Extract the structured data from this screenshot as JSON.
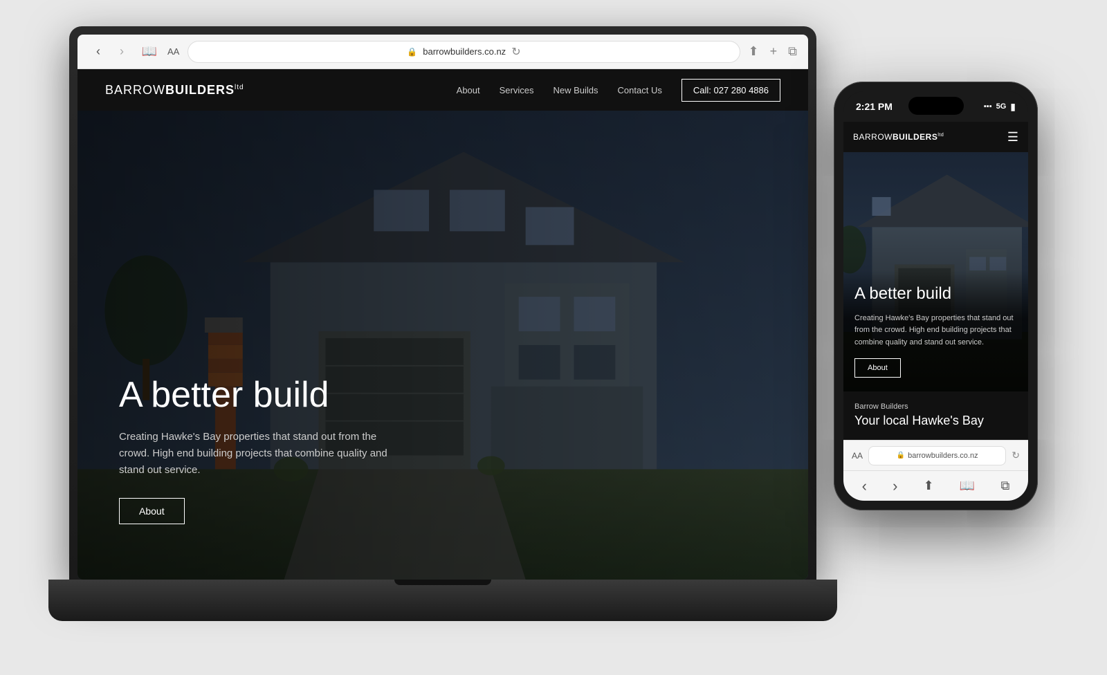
{
  "laptop": {
    "browser": {
      "aa_label": "AA",
      "url": "barrowbuilders.co.nz",
      "lock_symbol": "🔒",
      "refresh_symbol": "↻",
      "share_symbol": "⬆",
      "tabs_symbol": "⧉",
      "bookmark_symbol": "📖",
      "plus_symbol": "+"
    },
    "website": {
      "logo_text_normal": "BARROW",
      "logo_text_bold": "BUILDERS",
      "logo_super": "ltd",
      "nav_links": [
        "About",
        "Services",
        "New Builds",
        "Contact Us"
      ],
      "nav_cta": "Call: 027 280 4886",
      "hero_title": "A better build",
      "hero_subtitle": "Creating Hawke's Bay properties that stand out from the crowd. High end building projects that combine quality and stand out service.",
      "hero_button": "About"
    }
  },
  "phone": {
    "status_bar": {
      "time": "2:21 PM",
      "signal": "▪▪▪",
      "five_g": "5G",
      "battery": "▮"
    },
    "website": {
      "logo_text_normal": "BARROW",
      "logo_text_bold": "BUILDERS",
      "logo_super": "ltd",
      "hamburger": "☰",
      "hero_title": "A better build",
      "hero_subtitle": "Creating Hawke's Bay properties that stand out from the crowd. High end building projects that combine quality and stand out service.",
      "hero_button": "About",
      "section_label": "Barrow Builders",
      "section_title": "Your local Hawke's Bay"
    },
    "browser_bar": {
      "aa": "AA",
      "url": "barrowbuilders.co.nz",
      "lock": "🔒",
      "refresh": "↻"
    },
    "bottom_nav": {
      "back": "‹",
      "forward": "›",
      "share": "⬆",
      "bookmark": "📖",
      "tabs": "⧉"
    }
  }
}
